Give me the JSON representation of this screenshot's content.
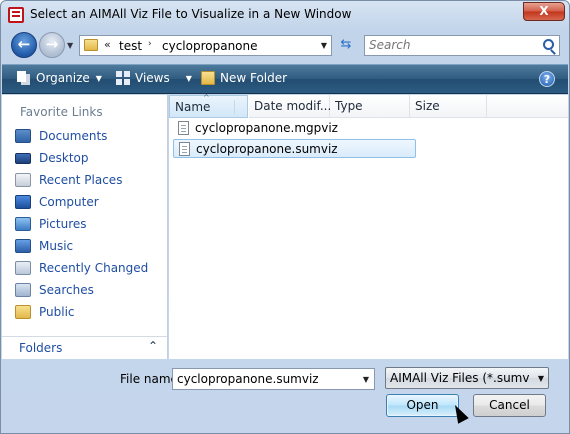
{
  "window": {
    "title": "Select an AIMAll Viz File to Visualize in a New Window",
    "close_label": "X"
  },
  "address": {
    "chevron": "«",
    "crumbs": [
      "test",
      "cyclopropanone"
    ],
    "separator": "›",
    "search_placeholder": "Search"
  },
  "toolbar": {
    "organize_label": "Organize",
    "views_label": "Views",
    "new_folder_label": "New Folder",
    "help_label": "?"
  },
  "nav_pane": {
    "header": "Favorite Links",
    "items": [
      {
        "label": "Documents",
        "icon": "documents-icon"
      },
      {
        "label": "Desktop",
        "icon": "desktop-icon"
      },
      {
        "label": "Recent Places",
        "icon": "recent-places-icon"
      },
      {
        "label": "Computer",
        "icon": "computer-icon"
      },
      {
        "label": "Pictures",
        "icon": "pictures-icon"
      },
      {
        "label": "Music",
        "icon": "music-icon"
      },
      {
        "label": "Recently Changed",
        "icon": "recently-changed-icon"
      },
      {
        "label": "Searches",
        "icon": "searches-icon"
      },
      {
        "label": "Public",
        "icon": "public-folder-icon"
      }
    ],
    "folders_label": "Folders"
  },
  "file_list": {
    "columns": [
      "Name",
      "Date modif...",
      "Type",
      "Size"
    ],
    "files": [
      {
        "name": "cyclopropanone.mgpviz",
        "selected": false
      },
      {
        "name": "cyclopropanone.sumviz",
        "selected": true
      }
    ]
  },
  "bottom": {
    "file_name_label": "File name:",
    "file_name_value": "cyclopropanone.sumviz",
    "filter_value": "AIMAll Viz Files (*.sumviz *.mgpviz)",
    "open_label": "Open",
    "cancel_label": "Cancel"
  },
  "colors": {
    "link_blue": "#1f4ea1",
    "toolbar_blue": "#2f5b80",
    "selection_bg": "#d9ebfb"
  }
}
